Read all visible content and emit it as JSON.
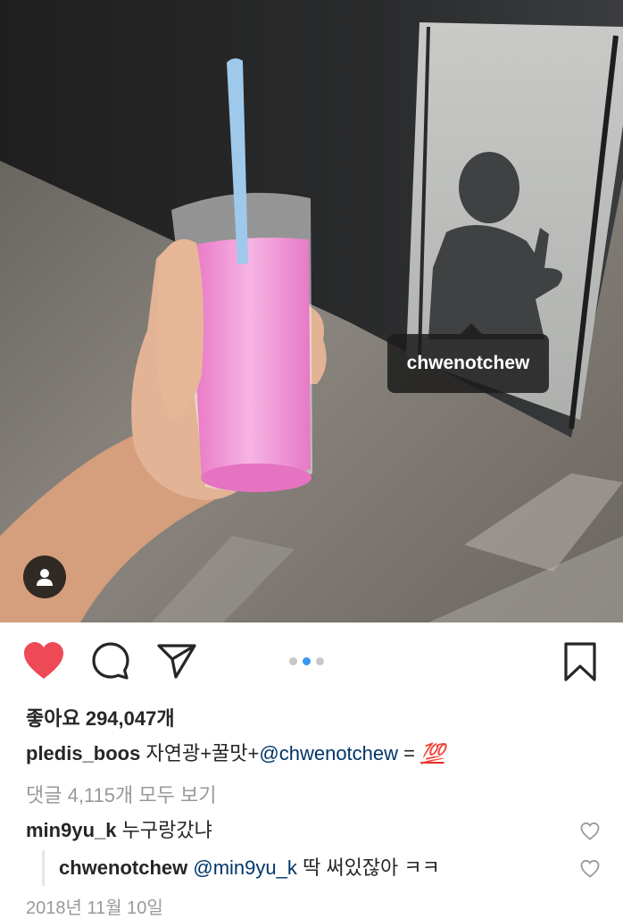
{
  "photo": {
    "tag_label": "chwenotchew",
    "user_tag_icon": "person-icon"
  },
  "actions": {
    "like_icon": "heart-filled-icon",
    "like_color": "#ed4956",
    "comment_icon": "comment-bubble-icon",
    "share_icon": "paper-plane-icon",
    "save_icon": "bookmark-icon",
    "carousel_dots": 3,
    "carousel_active": 1,
    "dot_active_color": "#3897f0"
  },
  "likes": "좋아요 294,047개",
  "caption": {
    "username": "pledis_boos",
    "text": "자연광+꿀맛+",
    "mention": "@chwenotchew",
    "suffix": " = ",
    "emoji": "💯",
    "emoji_icon": "hundred-points-emoji"
  },
  "view_all_comments": "댓글 4,115개 모두 보기",
  "comments": [
    {
      "username": "min9yu_k",
      "text": "누구랑갔냐"
    },
    {
      "username": "chwenotchew",
      "mention": "@min9yu_k",
      "text": " 딱 써있잖아 ㅋㅋ"
    }
  ],
  "date": "2018년 11월 10일"
}
